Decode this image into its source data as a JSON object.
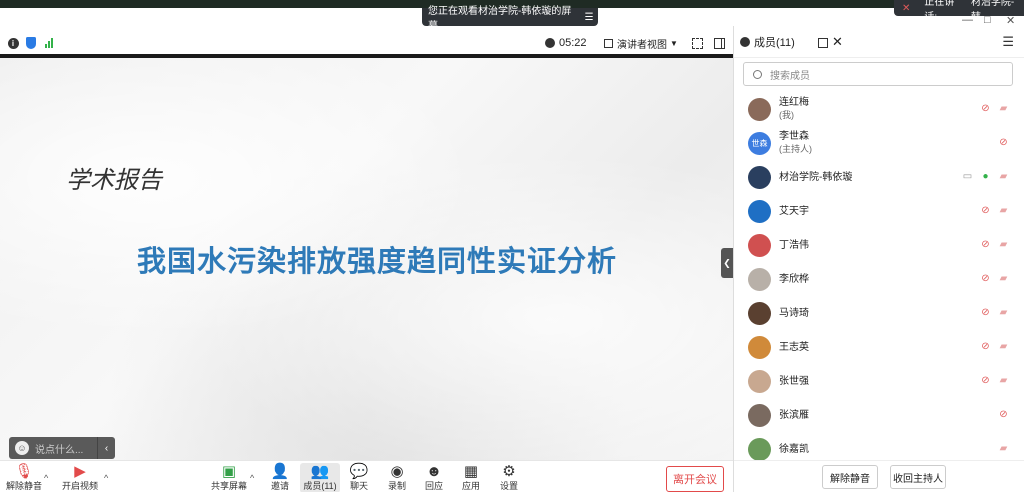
{
  "top": {
    "viewing_banner": "您正在观看材治学院-韩依璇的屏幕",
    "speaking_label": "正在讲话:",
    "speaking_name": "材治学院-韩"
  },
  "header": {
    "timer": "05:22",
    "presenter_view": "演讲者视图"
  },
  "slide": {
    "subtitle": "学术报告",
    "title": "我国水污染排放强度趋同性实证分析",
    "chat_placeholder": "说点什么..."
  },
  "toolbar": {
    "unmute": "解除静音",
    "start_video": "开启视频",
    "share_screen": "共享屏幕",
    "invite": "邀请",
    "members": "成员(11)",
    "chat": "聊天",
    "record": "录制",
    "react": "回应",
    "apps": "应用",
    "settings": "设置",
    "leave": "离开会议"
  },
  "panel": {
    "title": "成员(11)",
    "search_placeholder": "搜索成员",
    "participants": [
      {
        "name": "连红梅",
        "role": "(我)",
        "avatar_text": "",
        "avatar_color": "#8a6a5a",
        "mic": "off",
        "cam": "off"
      },
      {
        "name": "李世森",
        "role": "(主持人)",
        "avatar_text": "世森",
        "avatar_color": "#3d7de0",
        "mic": "off",
        "cam": "none"
      },
      {
        "name": "材治学院-韩依璇",
        "role": "",
        "avatar_text": "",
        "avatar_color": "#2a3f5f",
        "mic": "on",
        "cam": "off",
        "sharing": true
      },
      {
        "name": "艾天宇",
        "role": "",
        "avatar_text": "",
        "avatar_color": "#1f6fc4",
        "mic": "off",
        "cam": "off"
      },
      {
        "name": "丁浩伟",
        "role": "",
        "avatar_text": "",
        "avatar_color": "#d05050",
        "mic": "off",
        "cam": "off"
      },
      {
        "name": "李欣桦",
        "role": "",
        "avatar_text": "",
        "avatar_color": "#b8b0a8",
        "mic": "off",
        "cam": "off"
      },
      {
        "name": "马诗琦",
        "role": "",
        "avatar_text": "",
        "avatar_color": "#5a4030",
        "mic": "off",
        "cam": "off"
      },
      {
        "name": "王志英",
        "role": "",
        "avatar_text": "",
        "avatar_color": "#d08a3a",
        "mic": "off",
        "cam": "off"
      },
      {
        "name": "张世强",
        "role": "",
        "avatar_text": "",
        "avatar_color": "#c8a890",
        "mic": "off",
        "cam": "off"
      },
      {
        "name": "张滨雁",
        "role": "",
        "avatar_text": "",
        "avatar_color": "#7a6a60",
        "mic": "off",
        "cam": "none"
      },
      {
        "name": "徐嘉凯",
        "role": "",
        "avatar_text": "",
        "avatar_color": "#6a9a5a",
        "mic": "none",
        "cam": "off"
      }
    ],
    "mute_all": "解除静音",
    "reclaim_host": "收回主持人"
  }
}
